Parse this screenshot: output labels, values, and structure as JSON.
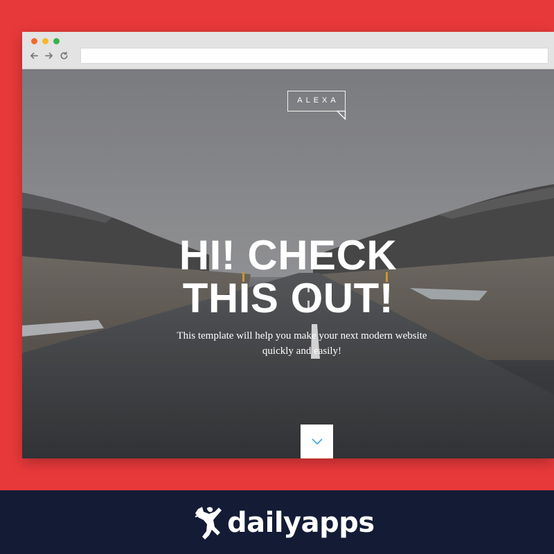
{
  "browser": {
    "traffic_lights": [
      "close",
      "minimize",
      "maximize"
    ],
    "nav_icons": [
      "back-arrow-icon",
      "forward-arrow-icon",
      "reload-icon"
    ],
    "url": ""
  },
  "hero": {
    "logo_text": "ALEXA",
    "headline_line1": "HI! CHECK",
    "headline_line2": "THIS OUT!",
    "subtext_line1": "This template will help you make your next modern website",
    "subtext_line2": "quickly and easily!",
    "scroll_icon": "chevron-down-icon"
  },
  "footer": {
    "brand_name": "dailyapps",
    "brand_icon": "leaping-figure-logo-icon"
  },
  "colors": {
    "background": "#e8393a",
    "footer": "#141b35",
    "accent_chevron": "#3aa7d8"
  }
}
